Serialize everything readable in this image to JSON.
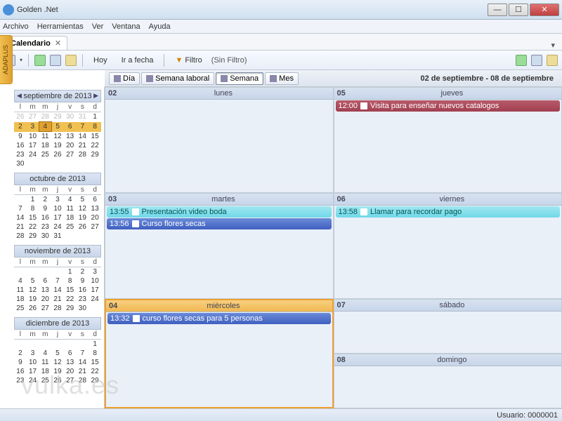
{
  "window": {
    "title": "Golden .Net"
  },
  "menu": {
    "archivo": "Archivo",
    "herramientas": "Herramientas",
    "ver": "Ver",
    "ventana": "Ventana",
    "ayuda": "Ayuda"
  },
  "tab": {
    "label": "Calendario"
  },
  "toolbar": {
    "hoy": "Hoy",
    "ir_a_fecha": "Ir a fecha",
    "filtro": "Filtro",
    "sin_filtro": "(Sin Filtro)"
  },
  "viewbar": {
    "dia": "Día",
    "semana_laboral": "Semana laboral",
    "semana": "Semana",
    "mes": "Mes",
    "range": "02 de septiembre - 08 de septiembre"
  },
  "side_label": "ADAPLUS",
  "minicals": [
    {
      "title": "septiembre de 2013",
      "nav": true,
      "headers": [
        "l",
        "m",
        "m",
        "j",
        "v",
        "s",
        "d"
      ],
      "rows": [
        [
          {
            "d": 26,
            "o": 1
          },
          {
            "d": 27,
            "o": 1
          },
          {
            "d": 28,
            "o": 1
          },
          {
            "d": 29,
            "o": 1
          },
          {
            "d": 30,
            "o": 1
          },
          {
            "d": 31,
            "o": 1
          },
          {
            "d": 1
          }
        ],
        [
          {
            "d": 2,
            "h": 1
          },
          {
            "d": 3,
            "h": 1
          },
          {
            "d": 4,
            "t": 1
          },
          {
            "d": 5,
            "h": 1
          },
          {
            "d": 6,
            "h": 1
          },
          {
            "d": 7,
            "h": 1
          },
          {
            "d": 8,
            "h": 1
          }
        ],
        [
          {
            "d": 9
          },
          {
            "d": 10
          },
          {
            "d": 11
          },
          {
            "d": 12
          },
          {
            "d": 13
          },
          {
            "d": 14
          },
          {
            "d": 15
          }
        ],
        [
          {
            "d": 16
          },
          {
            "d": 17
          },
          {
            "d": 18
          },
          {
            "d": 19
          },
          {
            "d": 20
          },
          {
            "d": 21
          },
          {
            "d": 22
          }
        ],
        [
          {
            "d": 23
          },
          {
            "d": 24
          },
          {
            "d": 25
          },
          {
            "d": 26
          },
          {
            "d": 27
          },
          {
            "d": 28
          },
          {
            "d": 29
          }
        ],
        [
          {
            "d": 30
          },
          {
            "d": ""
          },
          {
            "d": ""
          },
          {
            "d": ""
          },
          {
            "d": ""
          },
          {
            "d": ""
          },
          {
            "d": ""
          }
        ]
      ]
    },
    {
      "title": "octubre de 2013",
      "headers": [
        "l",
        "m",
        "m",
        "j",
        "v",
        "s",
        "d"
      ],
      "rows": [
        [
          {
            "d": ""
          },
          {
            "d": 1
          },
          {
            "d": 2
          },
          {
            "d": 3
          },
          {
            "d": 4
          },
          {
            "d": 5
          },
          {
            "d": 6
          }
        ],
        [
          {
            "d": 7
          },
          {
            "d": 8
          },
          {
            "d": 9
          },
          {
            "d": 10
          },
          {
            "d": 11
          },
          {
            "d": 12
          },
          {
            "d": 13
          }
        ],
        [
          {
            "d": 14
          },
          {
            "d": 15
          },
          {
            "d": 16
          },
          {
            "d": 17
          },
          {
            "d": 18
          },
          {
            "d": 19
          },
          {
            "d": 20
          }
        ],
        [
          {
            "d": 21
          },
          {
            "d": 22
          },
          {
            "d": 23
          },
          {
            "d": 24
          },
          {
            "d": 25
          },
          {
            "d": 26
          },
          {
            "d": 27
          }
        ],
        [
          {
            "d": 28
          },
          {
            "d": 29
          },
          {
            "d": 30
          },
          {
            "d": 31
          },
          {
            "d": ""
          },
          {
            "d": ""
          },
          {
            "d": ""
          }
        ]
      ]
    },
    {
      "title": "noviembre de 2013",
      "headers": [
        "l",
        "m",
        "m",
        "j",
        "v",
        "s",
        "d"
      ],
      "rows": [
        [
          {
            "d": ""
          },
          {
            "d": ""
          },
          {
            "d": ""
          },
          {
            "d": ""
          },
          {
            "d": 1
          },
          {
            "d": 2
          },
          {
            "d": 3
          }
        ],
        [
          {
            "d": 4
          },
          {
            "d": 5
          },
          {
            "d": 6
          },
          {
            "d": 7
          },
          {
            "d": 8
          },
          {
            "d": 9
          },
          {
            "d": 10
          }
        ],
        [
          {
            "d": 11
          },
          {
            "d": 12
          },
          {
            "d": 13
          },
          {
            "d": 14
          },
          {
            "d": 15
          },
          {
            "d": 16
          },
          {
            "d": 17
          }
        ],
        [
          {
            "d": 18
          },
          {
            "d": 19
          },
          {
            "d": 20
          },
          {
            "d": 21
          },
          {
            "d": 22
          },
          {
            "d": 23
          },
          {
            "d": 24
          }
        ],
        [
          {
            "d": 25
          },
          {
            "d": 26
          },
          {
            "d": 27
          },
          {
            "d": 28
          },
          {
            "d": 29
          },
          {
            "d": 30
          },
          {
            "d": ""
          }
        ]
      ]
    },
    {
      "title": "diciembre de 2013",
      "headers": [
        "l",
        "m",
        "m",
        "j",
        "v",
        "s",
        "d"
      ],
      "rows": [
        [
          {
            "d": ""
          },
          {
            "d": ""
          },
          {
            "d": ""
          },
          {
            "d": ""
          },
          {
            "d": ""
          },
          {
            "d": ""
          },
          {
            "d": 1
          }
        ],
        [
          {
            "d": 2
          },
          {
            "d": 3
          },
          {
            "d": 4
          },
          {
            "d": 5
          },
          {
            "d": 6
          },
          {
            "d": 7
          },
          {
            "d": 8
          }
        ],
        [
          {
            "d": 9
          },
          {
            "d": 10
          },
          {
            "d": 11
          },
          {
            "d": 12
          },
          {
            "d": 13
          },
          {
            "d": 14
          },
          {
            "d": 15
          }
        ],
        [
          {
            "d": 16
          },
          {
            "d": 17
          },
          {
            "d": 18
          },
          {
            "d": 19
          },
          {
            "d": 20
          },
          {
            "d": 21
          },
          {
            "d": 22
          }
        ],
        [
          {
            "d": 23
          },
          {
            "d": 24
          },
          {
            "d": 25
          },
          {
            "d": 26
          },
          {
            "d": 27
          },
          {
            "d": 28
          },
          {
            "d": 29
          }
        ]
      ]
    }
  ],
  "days": {
    "mon": {
      "num": "02",
      "name": "lunes"
    },
    "tue": {
      "num": "03",
      "name": "martes"
    },
    "wed": {
      "num": "04",
      "name": "miércoles"
    },
    "thu": {
      "num": "05",
      "name": "jueves"
    },
    "fri": {
      "num": "06",
      "name": "viernes"
    },
    "sat": {
      "num": "07",
      "name": "sábado"
    },
    "sun": {
      "num": "08",
      "name": "domingo"
    }
  },
  "events": {
    "thu1": {
      "time": "12:00",
      "text": "Visita para enseñar nuevos catalogos"
    },
    "tue1": {
      "time": "13:55",
      "text": "Presentación video boda"
    },
    "tue2": {
      "time": "13:56",
      "text": "Curso flores secas"
    },
    "fri1": {
      "time": "13:58",
      "text": "Llamar para recordar pago"
    },
    "wed1": {
      "time": "13:32",
      "text": "curso flores secas para 5 personas"
    }
  },
  "status": {
    "user_label": "Usuario:",
    "user_value": "0000001"
  },
  "watermark": "vulka.es"
}
